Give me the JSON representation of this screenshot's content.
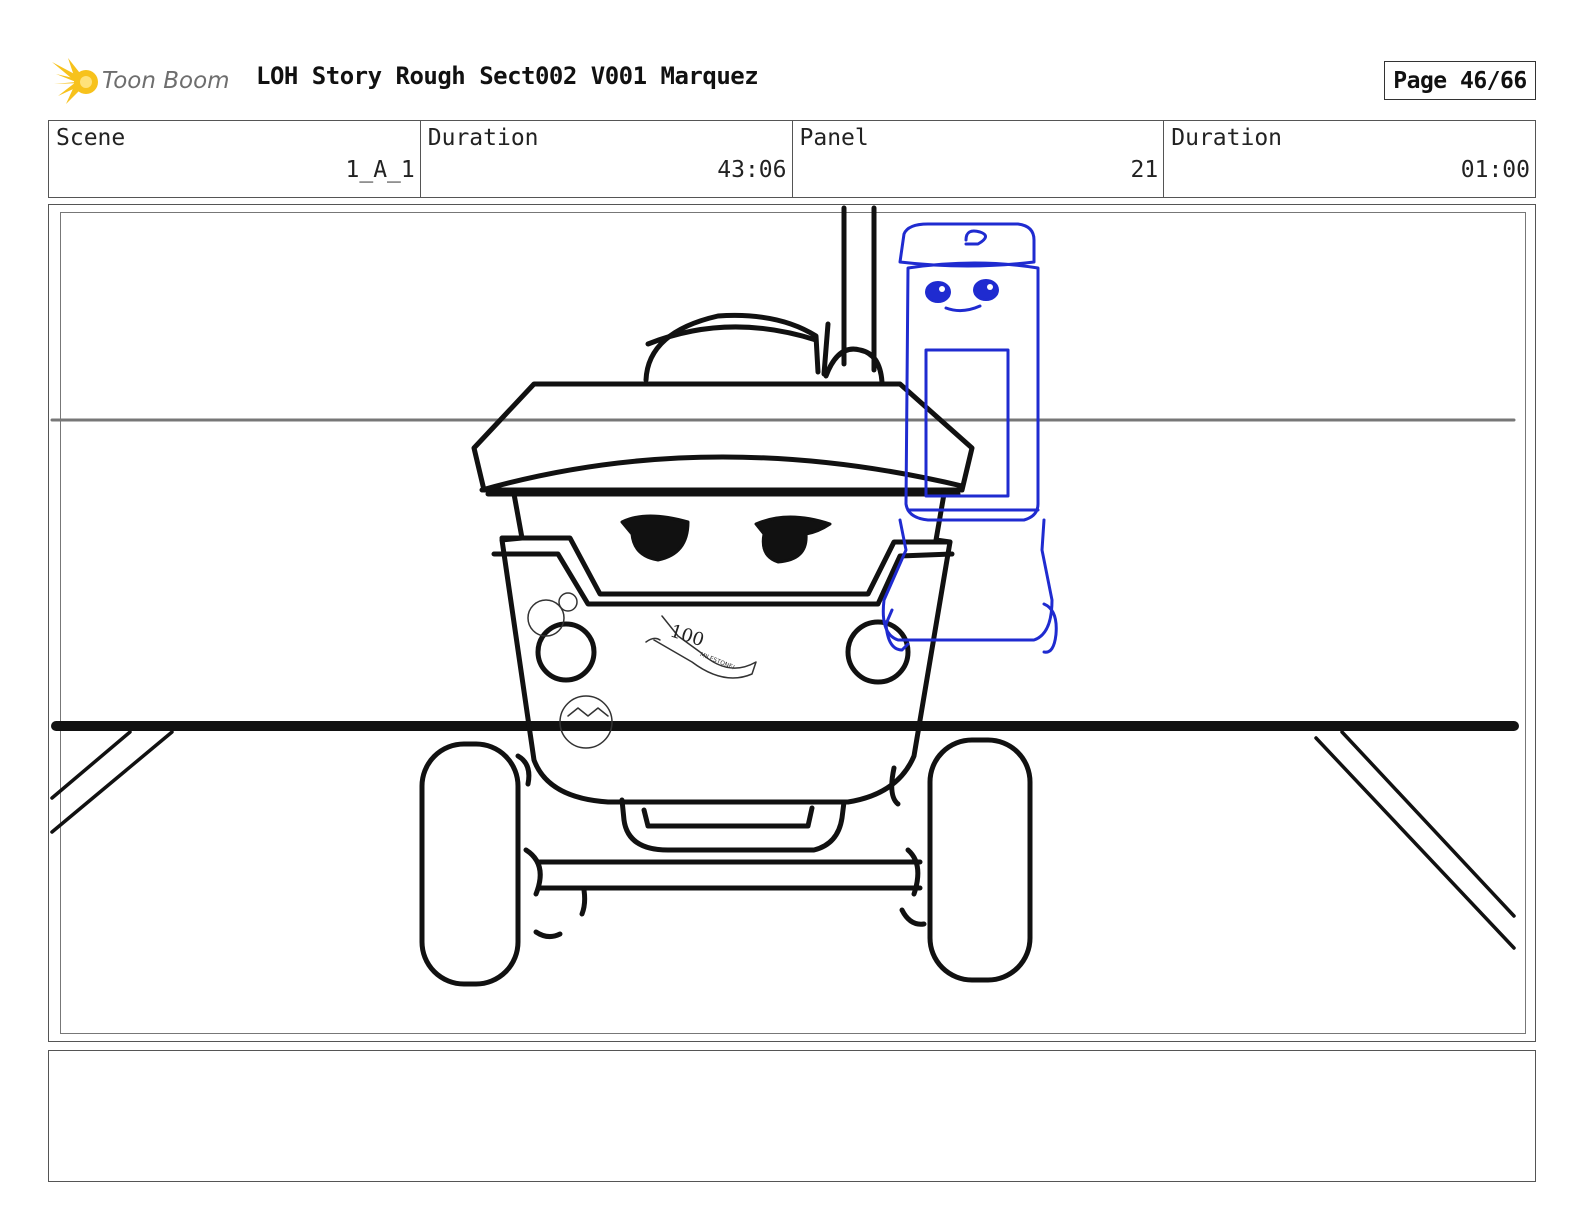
{
  "header": {
    "logo_text": "Toon Boom",
    "title": "LOH Story Rough Sect002 V001 Marquez",
    "page_label": "Page 46/66"
  },
  "info": {
    "scene_label": "Scene",
    "scene_value": "1_A_1",
    "scene_duration_label": "Duration",
    "scene_duration_value": "43:06",
    "panel_label": "Panel",
    "panel_value": "21",
    "panel_duration_label": "Duration",
    "panel_duration_value": "01:00"
  },
  "panel_art": {
    "sticker_banner_text": "100",
    "sticker_banner_subtext": "MILESTONE!",
    "character_colors": {
      "robot_cart": "#111111",
      "kiosk_robot": "#1f2bd0"
    }
  },
  "notes": {
    "text": ""
  }
}
